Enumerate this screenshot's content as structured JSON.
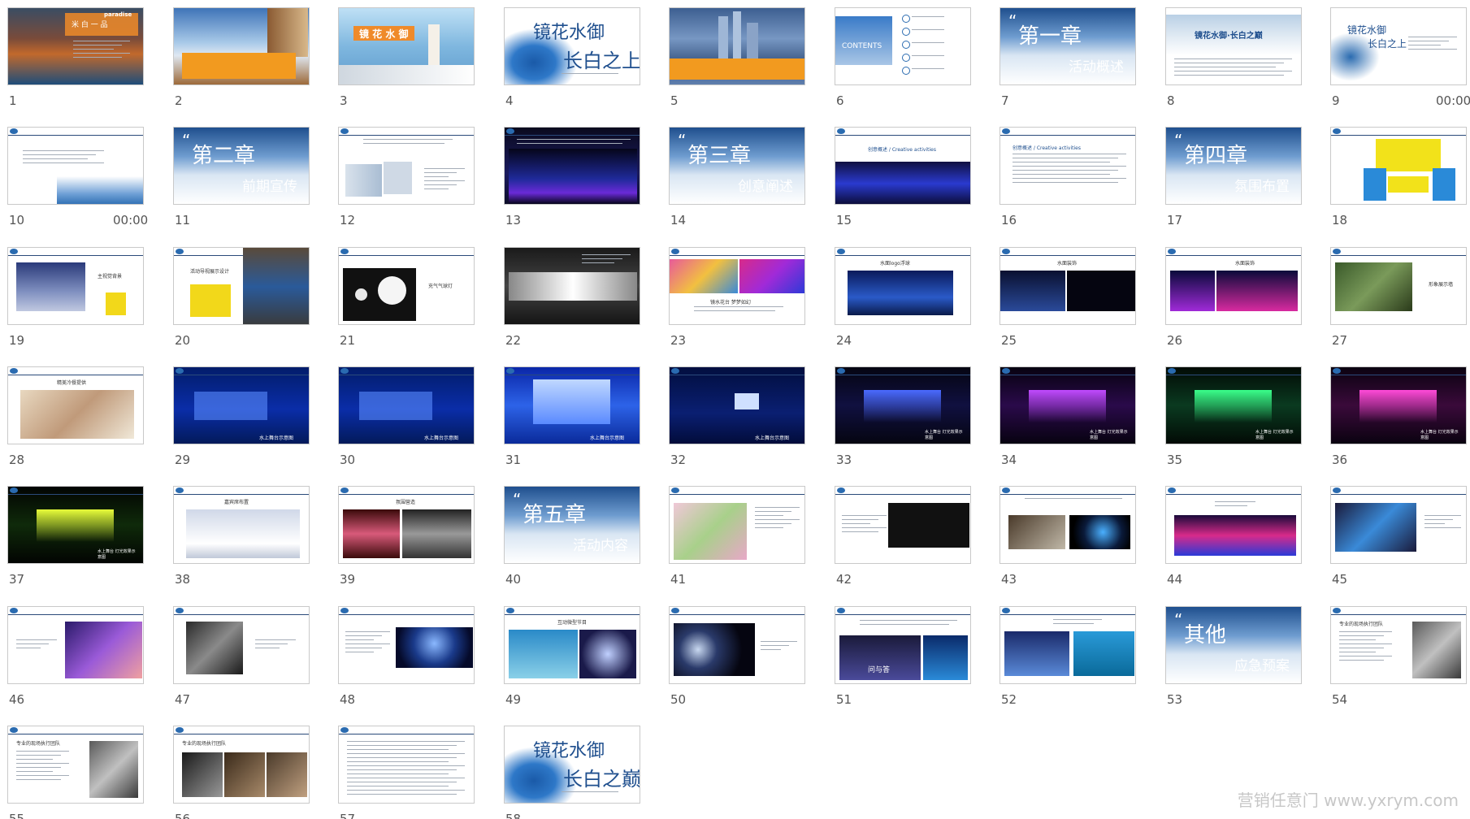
{
  "watermark": "营销任意门 www.yxrym.com",
  "slides": [
    {
      "num": "1",
      "time": "",
      "theme": "coastal-title",
      "texts": [
        "paradise",
        "米 白 一 品"
      ]
    },
    {
      "num": "2",
      "time": "",
      "theme": "sky-ship",
      "texts": []
    },
    {
      "num": "3",
      "time": "",
      "theme": "sea-balcony",
      "texts": [
        "镜 花 水 御"
      ]
    },
    {
      "num": "4",
      "time": "",
      "theme": "ink-cover",
      "texts": [
        "镜花水御",
        "长白之上"
      ]
    },
    {
      "num": "5",
      "time": "",
      "theme": "city-skyline",
      "texts": []
    },
    {
      "num": "6",
      "time": "",
      "theme": "contents",
      "texts": [
        "CONTENTS"
      ]
    },
    {
      "num": "7",
      "time": "",
      "theme": "chapter",
      "texts": [
        "第一章",
        "活动概述"
      ]
    },
    {
      "num": "8",
      "time": "",
      "theme": "banner-text",
      "texts": [
        "镜花水御·长白之巅"
      ]
    },
    {
      "num": "9",
      "time": "00:00",
      "theme": "ink-small",
      "texts": [
        "镜花水御",
        "长白之上"
      ]
    },
    {
      "num": "10",
      "time": "00:00",
      "theme": "text-wave",
      "texts": []
    },
    {
      "num": "11",
      "time": "",
      "theme": "chapter",
      "texts": [
        "第二章",
        "前期宣传"
      ]
    },
    {
      "num": "12",
      "time": "",
      "theme": "doc-images",
      "texts": []
    },
    {
      "num": "13",
      "time": "",
      "theme": "stage-dark",
      "texts": []
    },
    {
      "num": "14",
      "time": "",
      "theme": "chapter",
      "texts": [
        "第三章",
        "创意阐述"
      ]
    },
    {
      "num": "15",
      "time": "",
      "theme": "doc-stage",
      "texts": [
        "创意概述 / Creative activities"
      ]
    },
    {
      "num": "16",
      "time": "",
      "theme": "doc-text",
      "texts": [
        "创意概述 / Creative activities"
      ]
    },
    {
      "num": "17",
      "time": "",
      "theme": "chapter",
      "texts": [
        "第四章",
        "氛围布置"
      ]
    },
    {
      "num": "18",
      "time": "",
      "theme": "diagram-yellow",
      "texts": []
    },
    {
      "num": "19",
      "time": "",
      "theme": "doc-night",
      "texts": [
        "主视觉背景"
      ]
    },
    {
      "num": "20",
      "time": "",
      "theme": "doc-sign",
      "texts": [
        "活动导视展示设计"
      ]
    },
    {
      "num": "21",
      "time": "",
      "theme": "balloons",
      "texts": [
        "充气气球灯"
      ]
    },
    {
      "num": "22",
      "time": "",
      "theme": "logo-dark",
      "texts": []
    },
    {
      "num": "23",
      "time": "",
      "theme": "doc-colorful",
      "texts": [
        "镜水花台 梦梦如幻"
      ]
    },
    {
      "num": "24",
      "time": "",
      "theme": "doc-water",
      "texts": [
        "水面logo浮球"
      ]
    },
    {
      "num": "25",
      "time": "",
      "theme": "doc-lights",
      "texts": [
        "水面装饰"
      ]
    },
    {
      "num": "26",
      "time": "",
      "theme": "doc-laser",
      "texts": [
        "水面装饰"
      ]
    },
    {
      "num": "27",
      "time": "",
      "theme": "doc-green",
      "texts": [
        "形象展示墙"
      ]
    },
    {
      "num": "28",
      "time": "",
      "theme": "doc-food",
      "texts": [
        "精美冷餐提供"
      ]
    },
    {
      "num": "29",
      "time": "",
      "theme": "night-stage-blue",
      "texts": [
        "水上舞台示意图"
      ]
    },
    {
      "num": "30",
      "time": "",
      "theme": "night-stage-blue",
      "texts": [
        "水上舞台示意图"
      ]
    },
    {
      "num": "31",
      "time": "",
      "theme": "night-stage-bright",
      "texts": [
        "水上舞台示意图"
      ]
    },
    {
      "num": "32",
      "time": "",
      "theme": "night-stage-far",
      "texts": [
        "水上舞台示意图"
      ]
    },
    {
      "num": "33",
      "time": "",
      "theme": "concert-blue",
      "texts": [
        "水上舞台 灯光效果示意图"
      ]
    },
    {
      "num": "34",
      "time": "",
      "theme": "concert-purple",
      "texts": [
        "水上舞台 灯光效果示意图"
      ]
    },
    {
      "num": "35",
      "time": "",
      "theme": "concert-green",
      "texts": [
        "水上舞台 灯光效果示意图"
      ]
    },
    {
      "num": "36",
      "time": "",
      "theme": "concert-pink",
      "texts": [
        "水上舞台 灯光效果示意图"
      ]
    },
    {
      "num": "37",
      "time": "",
      "theme": "concert-yellow",
      "texts": [
        "水上舞台 灯光效果示意图"
      ]
    },
    {
      "num": "38",
      "time": "",
      "theme": "doc-seats",
      "texts": [
        "嘉宾席布置"
      ]
    },
    {
      "num": "39",
      "time": "",
      "theme": "doc-fountain",
      "texts": [
        "氛围营造"
      ]
    },
    {
      "num": "40",
      "time": "",
      "theme": "chapter",
      "texts": [
        "第五章",
        "活动内容"
      ]
    },
    {
      "num": "41",
      "time": "",
      "theme": "doc-dancers",
      "texts": []
    },
    {
      "num": "42",
      "time": "",
      "theme": "doc-dark-show",
      "texts": []
    },
    {
      "num": "43",
      "time": "",
      "theme": "doc-egg",
      "texts": []
    },
    {
      "num": "44",
      "time": "",
      "theme": "doc-concert",
      "texts": []
    },
    {
      "num": "45",
      "time": "",
      "theme": "doc-dance",
      "texts": []
    },
    {
      "num": "46",
      "time": "",
      "theme": "doc-host",
      "texts": []
    },
    {
      "num": "47",
      "time": "",
      "theme": "doc-speech",
      "texts": []
    },
    {
      "num": "48",
      "time": "",
      "theme": "doc-sphere",
      "texts": []
    },
    {
      "num": "49",
      "time": "",
      "theme": "doc-underwater",
      "texts": [
        "互动微型节目"
      ]
    },
    {
      "num": "50",
      "time": "",
      "theme": "doc-moon",
      "texts": []
    },
    {
      "num": "51",
      "time": "",
      "theme": "doc-screen",
      "texts": [
        "问与答"
      ]
    },
    {
      "num": "52",
      "time": "",
      "theme": "doc-mermaid",
      "texts": []
    },
    {
      "num": "53",
      "time": "",
      "theme": "chapter",
      "texts": [
        "其他",
        "应急预案"
      ]
    },
    {
      "num": "54",
      "time": "",
      "theme": "doc-team",
      "texts": [
        "专业的现场执行团队"
      ]
    },
    {
      "num": "55",
      "time": "",
      "theme": "doc-team2",
      "texts": [
        "专业的现场执行团队"
      ]
    },
    {
      "num": "56",
      "time": "",
      "theme": "doc-team3",
      "texts": [
        "专业的现场执行团队"
      ]
    },
    {
      "num": "57",
      "time": "",
      "theme": "doc-textonly",
      "texts": []
    },
    {
      "num": "58",
      "time": "",
      "theme": "ink-cover",
      "texts": [
        "镜花水御",
        "长白之巅"
      ]
    }
  ]
}
